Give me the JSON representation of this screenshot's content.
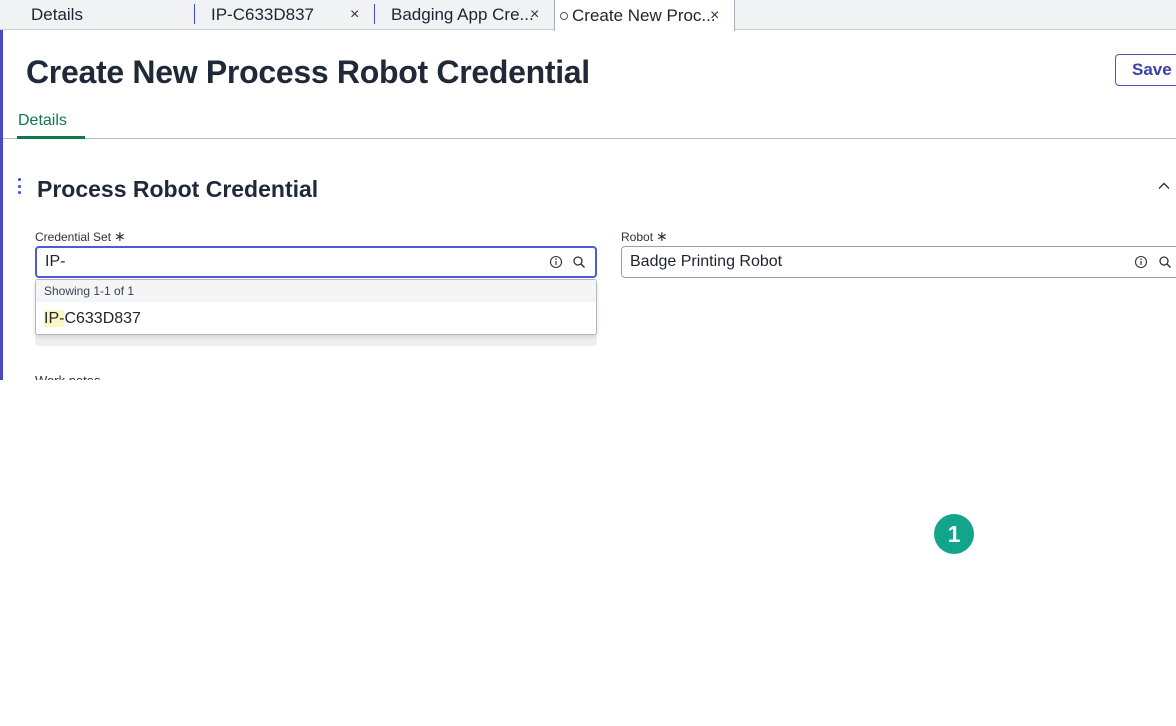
{
  "tabs": [
    {
      "label": "Details"
    },
    {
      "label": "IP-C633D837",
      "close": "×"
    },
    {
      "label": "Badging App Cre...",
      "close": "×"
    },
    {
      "label": "Create New Proc...",
      "close": "×"
    }
  ],
  "header": {
    "title": "Create New Process Robot Credential",
    "save_label": "Save"
  },
  "subtabs": {
    "details": "Details"
  },
  "section": {
    "title": "Process Robot Credential"
  },
  "fields": {
    "credential_set": {
      "label": "Credential Set",
      "required": "∗",
      "value": "IP-"
    },
    "robot": {
      "label": "Robot",
      "required": "∗",
      "value": "Badge Printing Robot"
    }
  },
  "dropdown": {
    "showing": "Showing 1-1 of 1",
    "item_match": "IP-",
    "item_rest": "C633D837"
  },
  "worknotes_label": "Work notes",
  "step_marker": "1",
  "colors": {
    "accent": "#4a47c9",
    "active_tab": "#11784a",
    "step_marker": "#13a58b"
  },
  "icons": [
    "close-icon",
    "kebab-icon",
    "chevron-up-icon",
    "info-icon",
    "search-icon"
  ]
}
